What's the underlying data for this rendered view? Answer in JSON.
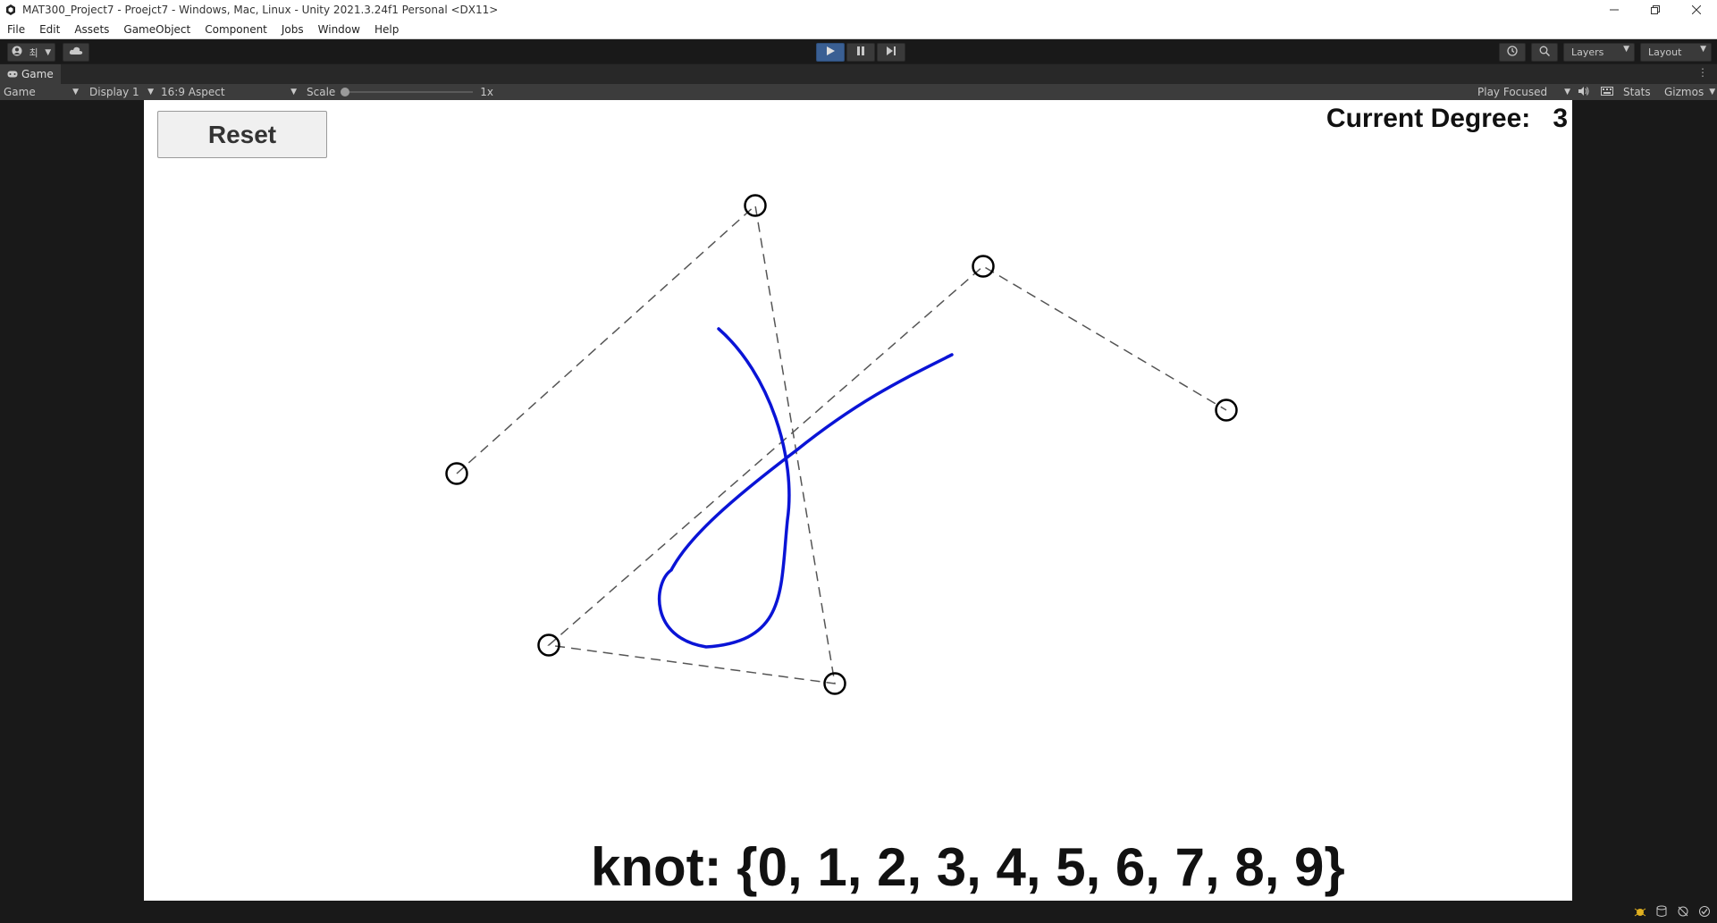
{
  "window": {
    "title": "MAT300_Project7 - Proejct7 - Windows, Mac, Linux - Unity 2021.3.24f1 Personal <DX11>"
  },
  "menu": {
    "items": [
      {
        "label": "File"
      },
      {
        "label": "Edit"
      },
      {
        "label": "Assets"
      },
      {
        "label": "GameObject"
      },
      {
        "label": "Component"
      },
      {
        "label": "Jobs"
      },
      {
        "label": "Window"
      },
      {
        "label": "Help"
      }
    ]
  },
  "toolbar": {
    "account_initial": "최",
    "layers_label": "Layers",
    "layout_label": "Layout",
    "play_active": true
  },
  "tab": {
    "label": "Game"
  },
  "gamebar": {
    "mode": "Game",
    "display": "Display 1",
    "aspect": "16:9 Aspect",
    "scale_label": "Scale",
    "scale_value": "1x",
    "play_focused": "Play Focused",
    "stats": "Stats",
    "gizmos": "Gizmos"
  },
  "game": {
    "reset_label": "Reset",
    "degree_label": "Current Degree:",
    "degree_value": "3",
    "knot_text": "knot: {0, 1, 2, 3, 4, 5, 6, 7, 8, 9}",
    "curve_color": "#0a14d6",
    "control_point_count": 6
  },
  "colors": {
    "play_active": "#3a5f93",
    "editor_dark": "#191919",
    "panel": "#3c3c3c"
  }
}
